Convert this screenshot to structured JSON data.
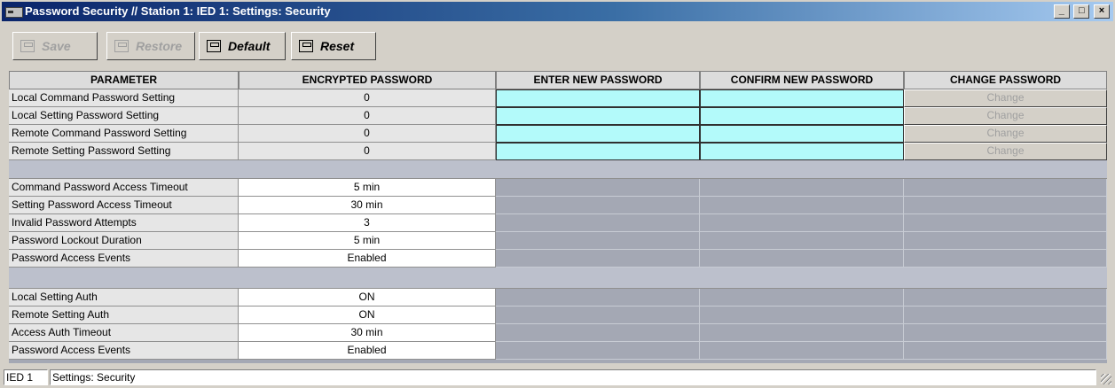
{
  "window": {
    "title": "Password Security // Station 1: IED 1: Settings: Security",
    "buttons": {
      "minimize": "_",
      "maximize": "□",
      "close": "×"
    }
  },
  "toolbar": {
    "save_label": "Save",
    "restore_label": "Restore",
    "default_label": "Default",
    "reset_label": "Reset"
  },
  "table": {
    "headers": [
      "PARAMETER",
      "ENCRYPTED PASSWORD",
      "ENTER NEW PASSWORD",
      "CONFIRM NEW PASSWORD",
      "CHANGE PASSWORD"
    ],
    "password_rows": [
      {
        "parameter": "Local Command Password Setting",
        "encrypted": "0",
        "change_label": "Change"
      },
      {
        "parameter": "Local Setting Password Setting",
        "encrypted": "0",
        "change_label": "Change"
      },
      {
        "parameter": "Remote Command Password Setting",
        "encrypted": "0",
        "change_label": "Change"
      },
      {
        "parameter": "Remote Setting Password Setting",
        "encrypted": "0",
        "change_label": "Change"
      }
    ],
    "timeout_rows": [
      {
        "parameter": "Command Password Access Timeout",
        "value": "5 min"
      },
      {
        "parameter": "Setting Password Access Timeout",
        "value": "30 min"
      },
      {
        "parameter": "Invalid Password Attempts",
        "value": "3"
      },
      {
        "parameter": "Password Lockout Duration",
        "value": "5 min"
      },
      {
        "parameter": "Password Access Events",
        "value": "Enabled"
      }
    ],
    "auth_rows": [
      {
        "parameter": "Local Setting Auth",
        "value": "ON"
      },
      {
        "parameter": "Remote Setting Auth",
        "value": "ON"
      },
      {
        "parameter": "Access Auth Timeout",
        "value": "30 min"
      },
      {
        "parameter": "Password Access Events",
        "value": "Enabled"
      }
    ]
  },
  "statusbar": {
    "device": "IED 1",
    "section": "Settings: Security"
  },
  "colors": {
    "entry_field": "#b3fafa",
    "title_gradient_start": "#0a246a",
    "grid_background": "#a4a8b4"
  }
}
